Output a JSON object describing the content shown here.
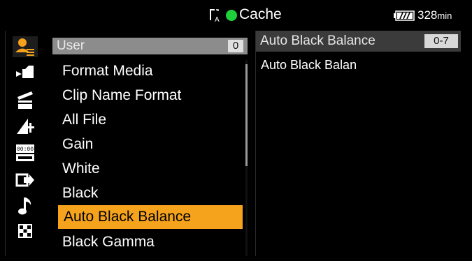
{
  "status_bar": {
    "media_label": "Cache",
    "record_indicator_color": "#1ed13a",
    "remaining_time": "328",
    "remaining_time_unit": "min",
    "media_icon": "media-lock-icon",
    "battery_icon": "battery-icon"
  },
  "categories": [
    {
      "icon": "user-menu-icon",
      "active": true
    },
    {
      "icon": "camera-icon",
      "active": false
    },
    {
      "icon": "clapper-icon",
      "active": false
    },
    {
      "icon": "paint-icon",
      "active": false
    },
    {
      "icon": "timecode-icon",
      "active": false
    },
    {
      "icon": "output-icon",
      "active": false
    },
    {
      "icon": "audio-icon",
      "active": false
    },
    {
      "icon": "grid-icon",
      "active": false
    }
  ],
  "menu": {
    "header_label": "User",
    "header_count": "0",
    "items": [
      {
        "label": "Format Media"
      },
      {
        "label": "Clip Name Format"
      },
      {
        "label": "All File"
      },
      {
        "label": "Gain"
      },
      {
        "label": "White"
      },
      {
        "label": "Black"
      },
      {
        "label": "Auto Black Balance",
        "selected": true
      },
      {
        "label": "Black Gamma"
      }
    ]
  },
  "detail": {
    "title": "Auto Black Balance",
    "range": "0-7",
    "value": "Auto Black Balan"
  },
  "colors": {
    "selected_bg": "#f5a21c",
    "header_bg": "#8c8c8c",
    "detail_header_bg": "#3b3b3b"
  }
}
